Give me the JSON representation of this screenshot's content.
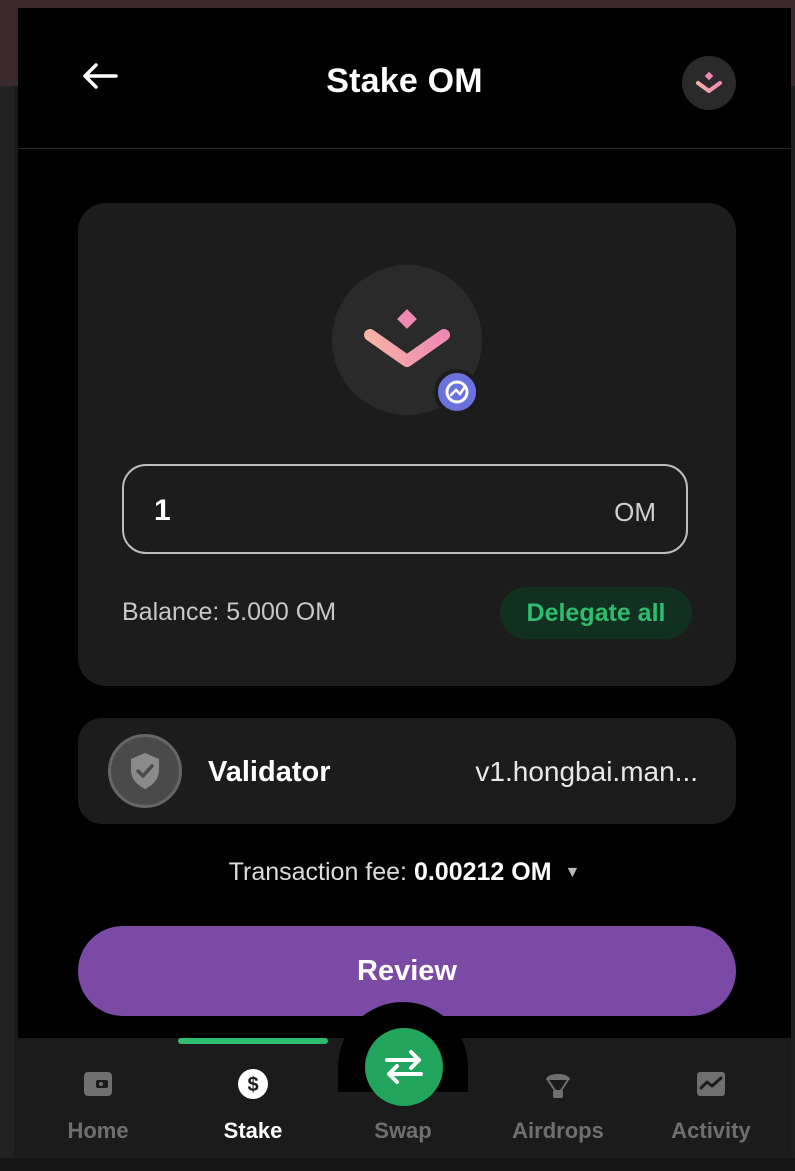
{
  "header": {
    "title": "Stake OM",
    "back_icon": "arrow-left-icon",
    "avatar_icon": "mantra-logo-icon"
  },
  "stake": {
    "amount_value": "1",
    "amount_unit": "OM",
    "balance_text": "Balance: 5.000 OM",
    "delegate_all_label": "Delegate all"
  },
  "validator": {
    "label": "Validator",
    "value": "v1.hongbai.man..."
  },
  "fee": {
    "label": "Transaction fee:",
    "value": "0.00212 OM"
  },
  "review_label": "Review",
  "nav": {
    "items": [
      {
        "label": "Home",
        "icon": "wallet-icon",
        "active": false
      },
      {
        "label": "Stake",
        "icon": "dollar-coin-icon",
        "active": true
      },
      {
        "label": "Swap",
        "icon": "swap-arrows-icon",
        "active": false
      },
      {
        "label": "Airdrops",
        "icon": "airdrop-icon",
        "active": false
      },
      {
        "label": "Activity",
        "icon": "activity-chart-icon",
        "active": false
      }
    ]
  },
  "colors": {
    "accent_green": "#2ebd6e",
    "review_purple": "#7b4aa5",
    "card_bg": "#1c1c1c",
    "logo_pink": "#f08ab4",
    "logo_peach": "#f6b2a4"
  }
}
